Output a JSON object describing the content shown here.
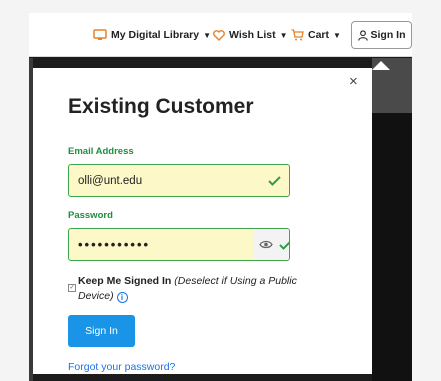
{
  "navbar": {
    "library_label": "My Digital Library",
    "wishlist_label": "Wish List",
    "cart_label": "Cart",
    "signin_label": "Sign In"
  },
  "panel": {
    "close_symbol": "×",
    "title": "Existing Customer",
    "email_label": "Email Address",
    "email_value": "olli@unt.edu",
    "password_label": "Password",
    "password_value": "•••••••••••",
    "keep_bold": "Keep Me Signed In",
    "keep_italic": "(Deselect if Using a Public Device)",
    "info_symbol": "i",
    "signin_button": "Sign In",
    "forgot_link": "Forgot your password?"
  },
  "icons": {
    "library": "monitor-icon",
    "wishlist": "heart-icon",
    "cart": "cart-icon",
    "signin": "user-icon",
    "valid": "check-icon",
    "reveal": "eye-icon",
    "info": "info-icon"
  },
  "colors": {
    "accent_orange": "#e8812a",
    "valid_green": "#2e9e48",
    "primary_blue": "#1994e6",
    "link_blue": "#1a73e8",
    "autofill_yellow": "#fcf8c8"
  }
}
